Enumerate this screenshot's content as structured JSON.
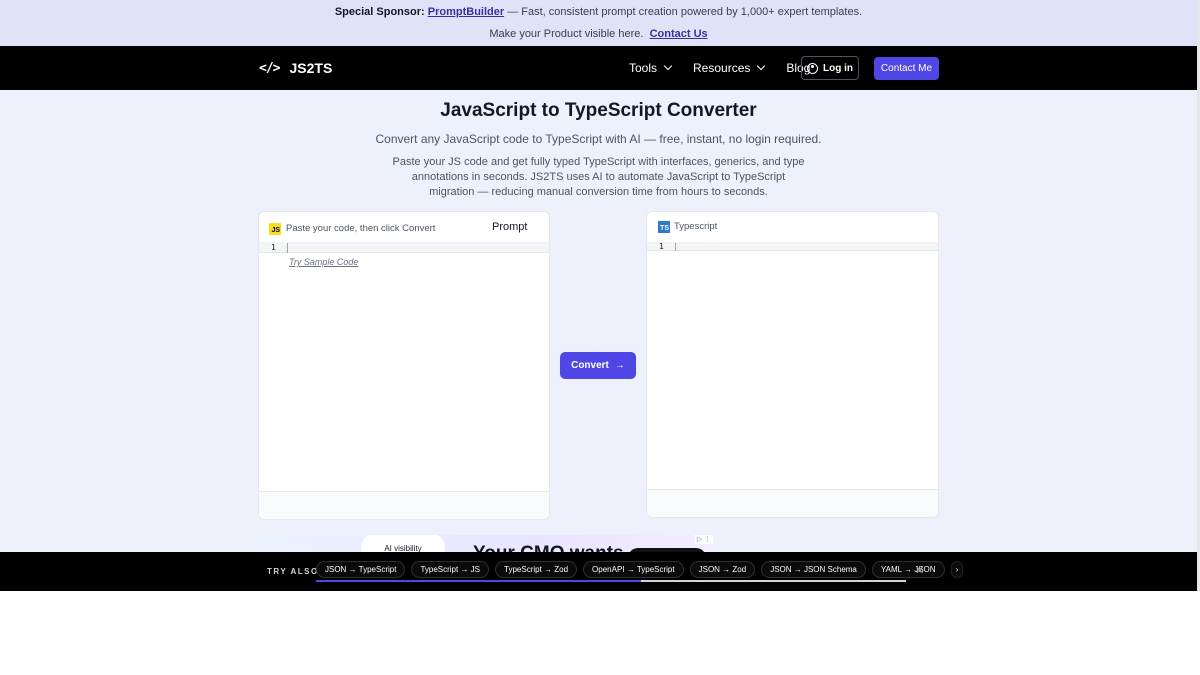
{
  "sponsor": {
    "label": "Special Sponsor:",
    "sponsor_name": "PromptBuilder",
    "sponsor_text": "— Fast, consistent prompt creation powered by 1,000+ expert templates.",
    "visibility_text": "Make your Product visible here.",
    "contact_link": "Contact Us"
  },
  "nav": {
    "logo_glyph": "</>",
    "logo_text": "JS2TS",
    "tools": "Tools",
    "resources": "Resources",
    "blog": "Blog",
    "login": "Log in",
    "contact": "Contact Me"
  },
  "hero": {
    "title": "JavaScript to TypeScript Converter",
    "subtitle": "Convert any JavaScript code to TypeScript with AI — free, instant, no login required.",
    "description": "Paste your JS code and get fully typed TypeScript with interfaces, generics, and type annotations in seconds. JS2TS uses AI to automate JavaScript to TypeScript migration — reducing manual conversion time from hours to seconds."
  },
  "input_panel": {
    "badge": "JS",
    "placeholder_text": "Paste your code, then click Convert",
    "prompt_tab": "Prompt",
    "line_number": "1",
    "sample_link": "Try Sample Code"
  },
  "output_panel": {
    "badge": "TS",
    "title": "Typescript",
    "line_number": "1"
  },
  "convert_button": {
    "label": "Convert",
    "arrow": "→"
  },
  "ad": {
    "bubble_text": "AI visibility",
    "headline": "Your CMO wants",
    "ad_choice": "▷ ⋮"
  },
  "try_also": {
    "label": "TRY ALSO",
    "chips": [
      "JSON → TypeScript",
      "TypeScript → JS",
      "TypeScript → Zod",
      "OpenAPI → TypeScript",
      "JSON → Zod",
      "JSON → JSON Schema",
      "YAML → JSON"
    ],
    "more": "›",
    "close": "✕",
    "progress": 0.55
  },
  "colors": {
    "accent": "#5046e5",
    "nav_bg": "#000000",
    "page_bg": "#eef0fb",
    "sponsor_bg": "#e0e3f7",
    "js_badge": "#f7df1e",
    "ts_badge": "#3178c6"
  }
}
